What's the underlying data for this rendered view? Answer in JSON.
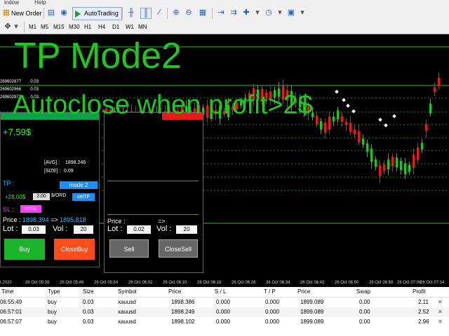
{
  "menubar": {
    "items": [
      "indow",
      "Help"
    ]
  },
  "toolbar": {
    "new_order": "New Order",
    "autotrading": "AutoTrading"
  },
  "timeframes": [
    "M1",
    "M5",
    "M15",
    "M30",
    "H1",
    "H4",
    "D1",
    "W1",
    "MN"
  ],
  "overlay": {
    "line1": "TP Mode2",
    "line2": "Autoclose when profit>2$"
  },
  "tickets": [
    {
      "id": "269602877",
      "vol": "0.03"
    },
    {
      "id": "269602966",
      "vol": "0.03"
    },
    {
      "id": "269602971",
      "vol": "0.03"
    }
  ],
  "buy_panel": {
    "profit": "+7.59$",
    "avg_label": "[AVG] :",
    "avg_value": "1898.246",
    "size_label": "[SIZE] :",
    "size_value": "0.09",
    "tp_label": "TP :",
    "mode_button": "mode 2",
    "tp_amount": "+28.00$",
    "tp_box": "2.00",
    "sord_label": "$/ORD",
    "settp_button": "setTP",
    "sl_label": "SL :",
    "setsl_button": "setSL",
    "price_label": "Price :",
    "price_from": "1898.394",
    "arrow": "=>",
    "price_to": "1895.818",
    "lot_label": "Lot :",
    "lot_value": "0.03",
    "vol_label": "Vol :",
    "vol_value": "20",
    "buy_button": "Buy",
    "closebuy_button": "CloseBuy"
  },
  "sell_panel": {
    "price_label": "Price :",
    "arrow": "=>",
    "lot_label": "Lot :",
    "lot_value": "0.02",
    "vol_label": "Vol :",
    "vol_value": "20",
    "sell_button": "Sell",
    "closesell_button": "CloseSell"
  },
  "time_axis": [
    "t 2020",
    "26 Oct 05:38",
    "26 Oct 05:46",
    "26 Oct 05:54",
    "26 Oct 06:02",
    "26 Oct 06:10",
    "26 Oct 06:18",
    "26 Oct 06:26",
    "26 Oct 06:34",
    "26 Oct 06:42",
    "26 Oct 06:50",
    "26 Oct 06:58",
    "26 Oct 07:06",
    "26 Oct 07:14"
  ],
  "trade_table": {
    "headers": [
      "Time",
      "Type",
      "Size",
      "Symbol",
      "Price",
      "S / L",
      "T / P",
      "Price",
      "Swap",
      "Profit"
    ],
    "rows": [
      [
        "06:55:49",
        "buy",
        "0.03",
        "xauusd",
        "1898.386",
        "0.000",
        "0.000",
        "1899.089",
        "0.00",
        "2.11"
      ],
      [
        "06:57:01",
        "buy",
        "0.03",
        "xauusd",
        "1898.249",
        "0.000",
        "0.000",
        "1899.089",
        "0.00",
        "2.52"
      ],
      [
        "06:57:07",
        "buy",
        "0.03",
        "xauusd",
        "1898.102",
        "0.000",
        "0.000",
        "1899.089",
        "0.00",
        "2.96"
      ]
    ]
  },
  "colors": {
    "bull": "#1ec81e",
    "bear": "#e81b1b",
    "accent_blue": "#1c8fff"
  }
}
